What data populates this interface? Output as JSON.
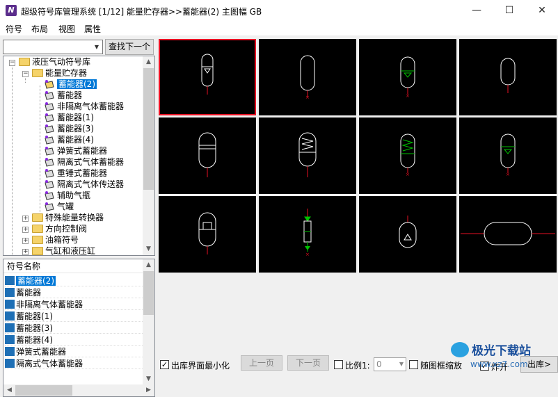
{
  "titlebar": {
    "title": "超级符号库管理系统 [1/12] 能量贮存器>>蓄能器(2) 主图幅 GB",
    "app_icon": "app-logo-icon",
    "minimize": "—",
    "maximize": "☐",
    "close": "✕"
  },
  "menubar": {
    "items": [
      "符号",
      "布局",
      "视图",
      "属性"
    ]
  },
  "search": {
    "value": "",
    "find_next": "查找下一个"
  },
  "tree": {
    "root": "液压气动符号库",
    "group": "能量贮存器",
    "children": [
      "蓄能器(2)",
      "蓄能器",
      "非隔离气体蓄能器",
      "蓄能器(1)",
      "蓄能器(3)",
      "蓄能器(4)",
      "弹簧式蓄能器",
      "隔离式气体蓄能器",
      "重锤式蓄能器",
      "隔离式气体传送器",
      "辅助气瓶",
      "气罐"
    ],
    "siblings": [
      "特殊能量转换器",
      "方向控制阀",
      "油箱符号",
      "气缸和液压缸"
    ]
  },
  "list": {
    "header": "符号名称",
    "items": [
      "蓄能器(2)",
      "蓄能器",
      "非隔离气体蓄能器",
      "蓄能器(1)",
      "蓄能器(3)",
      "蓄能器(4)",
      "弹簧式蓄能器",
      "隔离式气体蓄能器"
    ]
  },
  "bottombar": {
    "minimize_label": "出库界面最小化",
    "minimize_checked": true,
    "prev_page": "上一页",
    "next_page": "下一页",
    "ratio_label": "比例1:",
    "ratio_value": "0",
    "follow_zoom_label": "随图框缩放",
    "explode_label": "炸开",
    "explode_checked": true,
    "export_label": "出库"
  },
  "watermark": {
    "text": "极光下载站",
    "sub": "www.xz7.com"
  },
  "colors": {
    "selection": "#0078d7",
    "cell_bg": "#000000",
    "symbol_stroke": "#ffffff",
    "red": "#e81123",
    "green": "#00c000"
  }
}
